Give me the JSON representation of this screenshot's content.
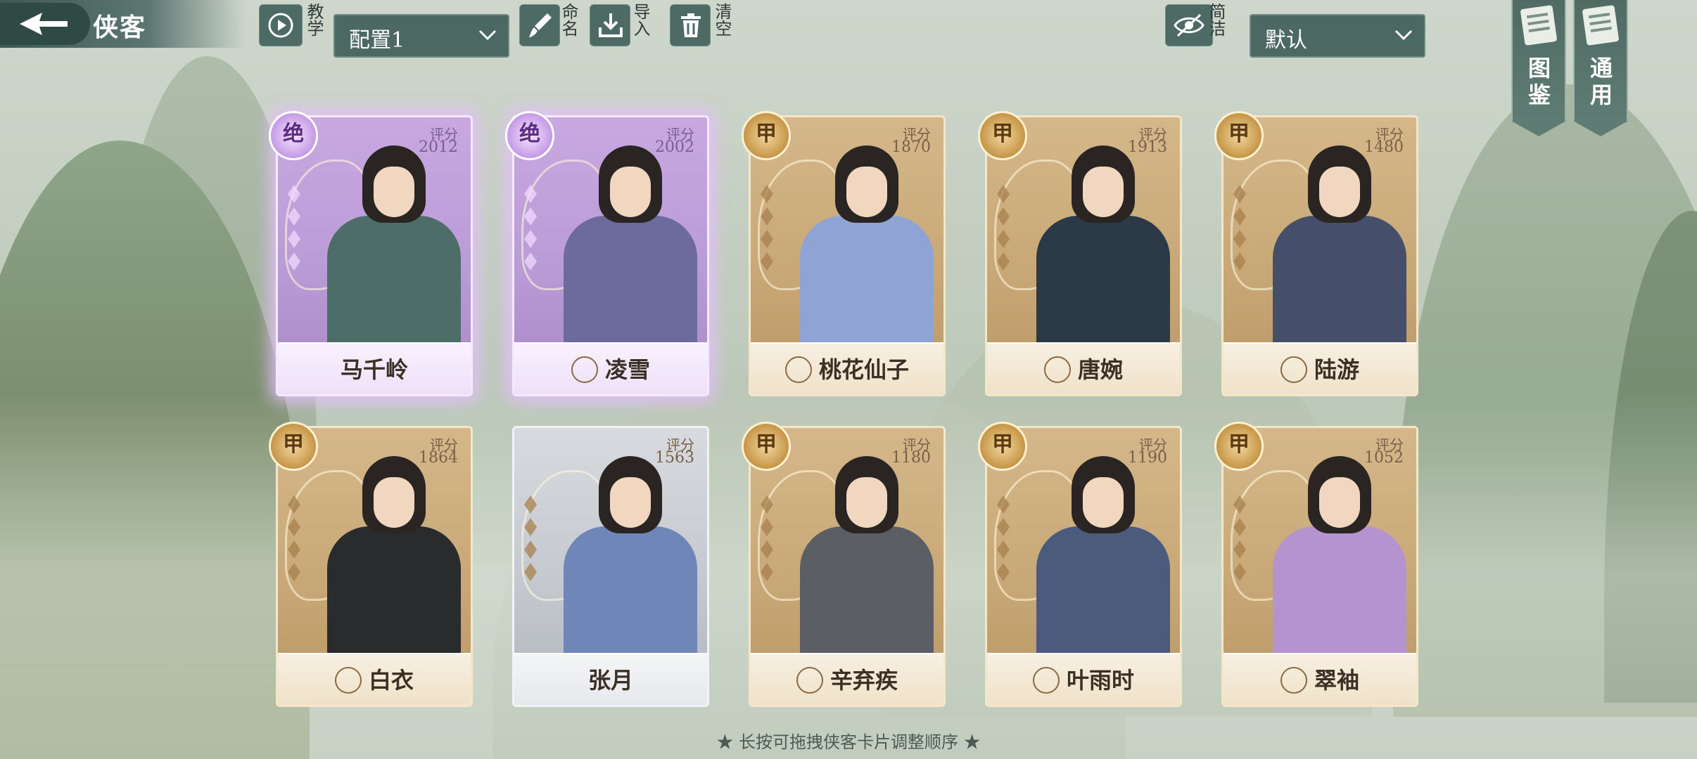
{
  "header": {
    "title": "侠客",
    "tutorial_label": "教学",
    "config_select": "配置1",
    "rename_label": "命名",
    "import_label": "导入",
    "clear_label": "清空",
    "simple_label": "简洁",
    "sort_select": "默认",
    "atlas_label": "图鉴",
    "general_label": "通用"
  },
  "score_label": "评分",
  "cards": [
    {
      "name": "马千岭",
      "grade": "绝",
      "score": "2012",
      "style": "purple",
      "robe": "#4f6d68",
      "icon": "none"
    },
    {
      "name": "凌雪",
      "grade": "绝",
      "score": "2002",
      "style": "purple",
      "robe": "#6d6a9c",
      "icon": "sword-icon"
    },
    {
      "name": "桃花仙子",
      "grade": "甲",
      "score": "1870",
      "style": "gold",
      "robe": "#8fa4d4",
      "icon": "lotus-icon"
    },
    {
      "name": "唐婉",
      "grade": "甲",
      "score": "1913",
      "style": "gold",
      "robe": "#2c3a48",
      "icon": "lotus-icon"
    },
    {
      "name": "陆游",
      "grade": "甲",
      "score": "1480",
      "style": "gold",
      "robe": "#464f6a",
      "icon": "yinyang-icon"
    },
    {
      "name": "白衣",
      "grade": "甲",
      "score": "1864",
      "style": "gold",
      "robe": "#2a2b2c",
      "icon": "shield-icon"
    },
    {
      "name": "张月",
      "grade": "",
      "score": "1563",
      "style": "silver",
      "robe": "#6f86b8",
      "icon": "none"
    },
    {
      "name": "辛弃疾",
      "grade": "甲",
      "score": "1180",
      "style": "gold",
      "robe": "#5b5f63",
      "icon": "sword-icon"
    },
    {
      "name": "叶雨时",
      "grade": "甲",
      "score": "1190",
      "style": "gold",
      "robe": "#4b5b7e",
      "icon": "shield-icon"
    },
    {
      "name": "翠袖",
      "grade": "甲",
      "score": "1052",
      "style": "gold",
      "robe": "#b493cf",
      "icon": "lotus-icon"
    }
  ],
  "hint": "★ 长按可拖拽侠客卡片调整顺序 ★"
}
